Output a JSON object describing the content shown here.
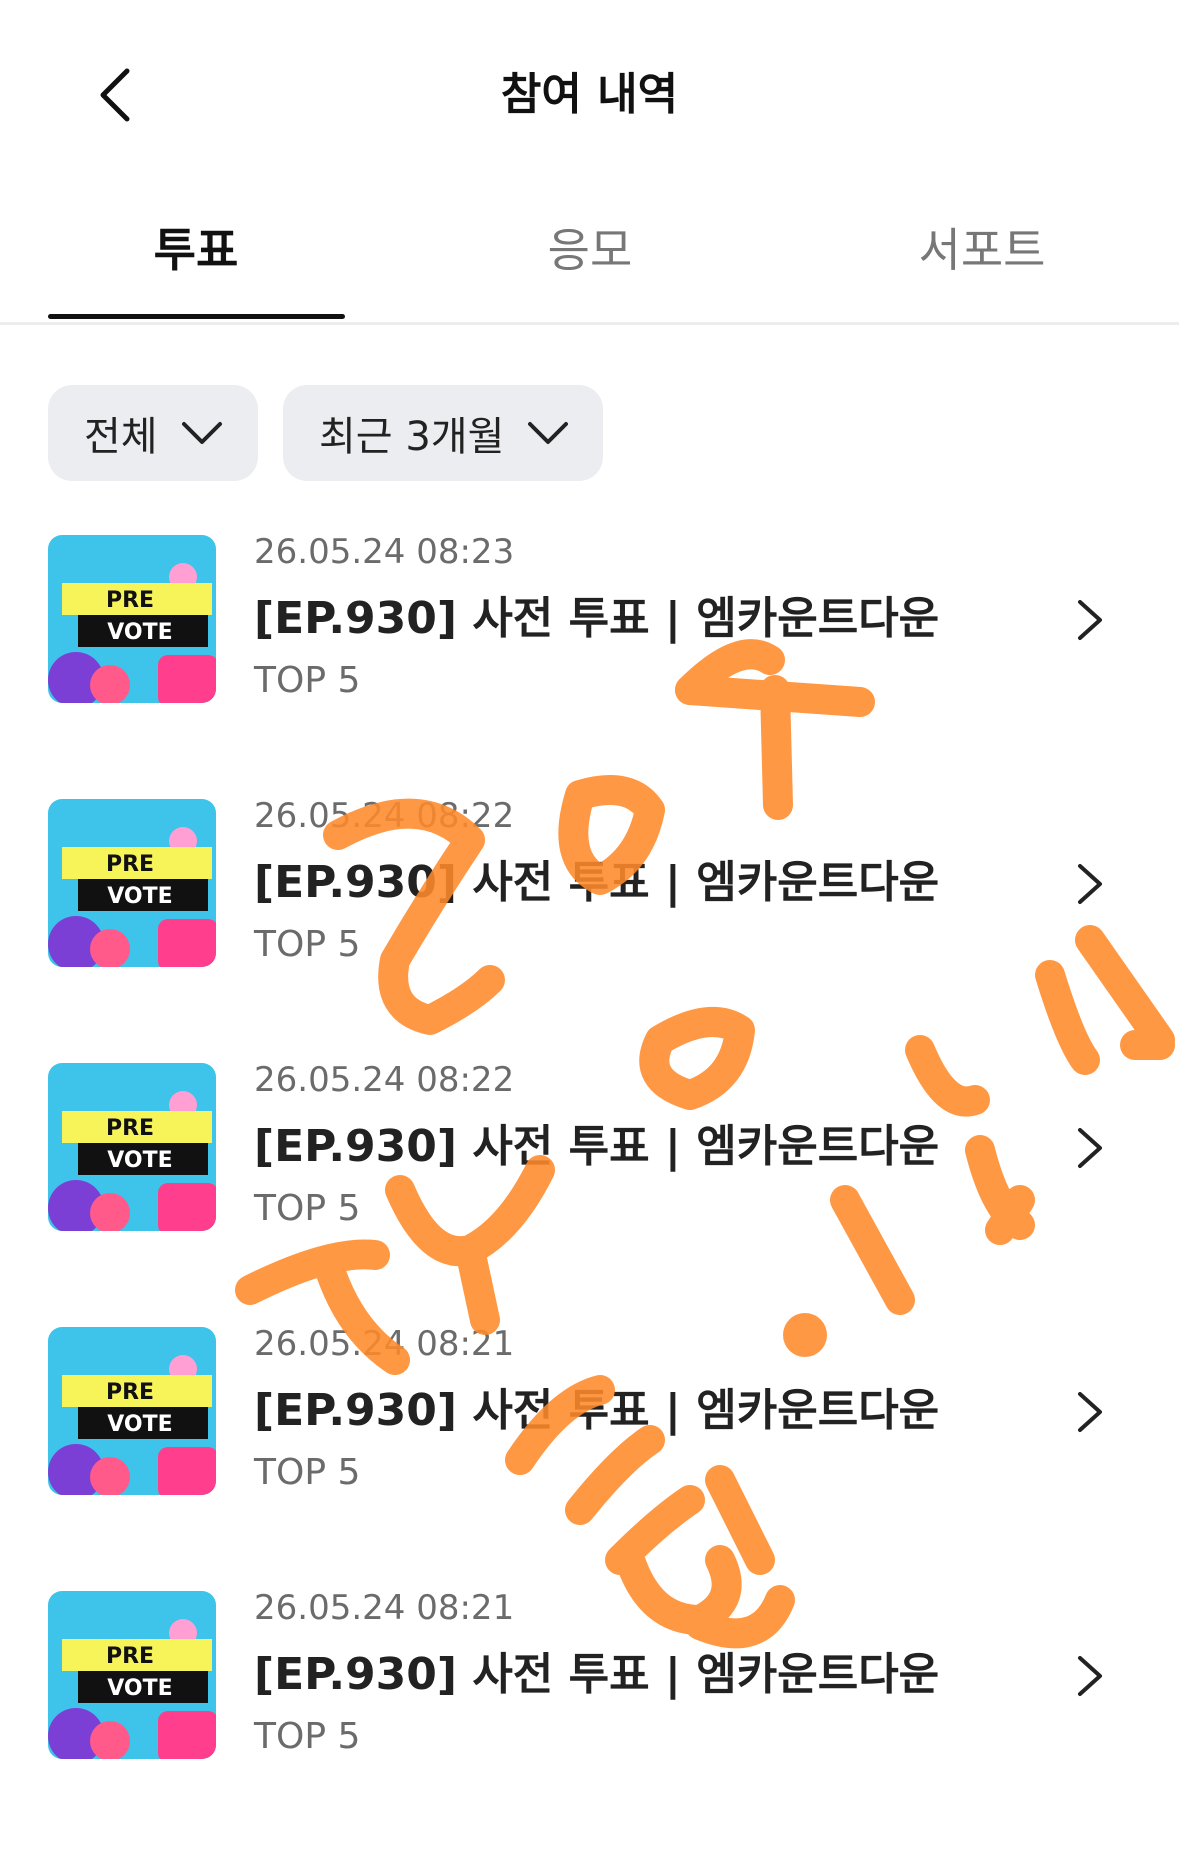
{
  "header": {
    "title": "참여 내역",
    "back_icon": "chevron-left-icon"
  },
  "tabs": [
    {
      "label": "투표",
      "active": true
    },
    {
      "label": "응모",
      "active": false
    },
    {
      "label": "서포트",
      "active": false
    }
  ],
  "filters": [
    {
      "label": "전체",
      "icon": "chevron-down-icon"
    },
    {
      "label": "최근 3개월",
      "icon": "chevron-down-icon"
    }
  ],
  "thumbnail": {
    "line1": "PRE",
    "line2": "VOTE"
  },
  "items": [
    {
      "date": "26.05.24 08:23",
      "title": "[EP.930] 사전 투표 | 엠카운트다운",
      "sub": "TOP 5"
    },
    {
      "date": "26.05.24 08:22",
      "title": "[EP.930] 사전 투표 | 엠카운트다운",
      "sub": "TOP 5"
    },
    {
      "date": "26.05.24 08:22",
      "title": "[EP.930] 사전 투표 | 엠카운트다운",
      "sub": "TOP 5"
    },
    {
      "date": "26.05.24 08:21",
      "title": "[EP.930] 사전 투표 | 엠카운트다운",
      "sub": "TOP 5"
    },
    {
      "date": "26.05.24 08:21",
      "title": "[EP.930] 사전 투표 | 엠카운트다운",
      "sub": "TOP 5"
    }
  ],
  "colors": {
    "accent": "#111111",
    "filter_bg": "#ecedf0",
    "overlay": "#ff8a2a"
  }
}
